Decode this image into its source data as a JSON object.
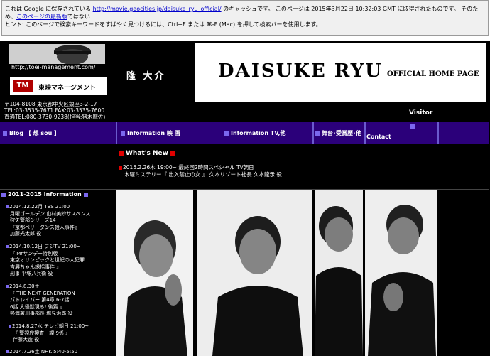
{
  "cache_banner": {
    "line1_a": "これは Google に保存されている ",
    "cached_url": "http://movie.geocities.jp/daisuke_ryu_official/",
    "line1_b": " のキャッシュです。 このページは 2015年3月22日 10:32:03 GMT に取得されたものです。 そのため、",
    "latest_link": "このページの最新版",
    "line1_c": "ではない",
    "line2": "ヒント: このページで検索キーワードをすばやく見つけるには、Ctrl+F または ⌘-F (Mac) を押して検索バーを使用します。"
  },
  "agency": {
    "url": "http://toei-management.com/",
    "name": "東映マネージメント",
    "address": "〒104-8108 東京都中央区銀座3-2-17",
    "tel": "TEL:03-3535-7671 FAX:03-3535-7600",
    "direct": "直通TEL:080-3730-9238(担当:猪木麿佐)"
  },
  "header": {
    "name_ja": "隆 大介",
    "name_en": "DAISUKE RYU",
    "subtitle": "OFFICIAL HOME PAGE",
    "visitor": "Visitor"
  },
  "nav": {
    "blog": "Blog 【 想 sou 】",
    "info_movie": "Information 映 画",
    "info_tv": "Information TV,他",
    "stage": "舞台･受賞歴･他",
    "contact": "Contact"
  },
  "whats_new": {
    "title": "What's New",
    "line1": "2015.2.26木 19:00~ 最終回2時間スペシャル TV朝日",
    "line2": "木曜ミステリー『 出入禁止の女 』 久本リゾート社長 久本龍示 役"
  },
  "sidebar": {
    "title": "2011-2015 Information",
    "items": [
      {
        "lines": [
          "2014.12.22月 TBS 21:00",
          "月曜ゴールデン 山村美紗サスペンス",
          "狩矢警部シリーズ14",
          "『京都ベリーダンス殺人事件』",
          "加藤光太郎 役"
        ]
      },
      {
        "lines": [
          "2014.10.12日 フジTV 21:00~",
          "『 Mrサンデー特別版",
          "東京オリンピックと世紀の大犯罪",
          "吉展ちゃん誘拐事件 』",
          "刑事 平塚八兵衛 役"
        ]
      },
      {
        "lines": [
          "2014.8.30土",
          "『 THE NEXT GENERATION",
          "パトレイバー 第4章 6-7話",
          "6話 大怪獣現る! 後篇 』",
          "熱海署刑事部長 塩見治郎 役"
        ]
      },
      {
        "lines": [
          "2014.8.27水 テレビ朝日 21:00~",
          "『 警視庁捜査一課 9係 』",
          "伴藤大造 役"
        ]
      },
      {
        "lines": [
          "2014.7.26土 NHK 5:40-5:50"
        ]
      }
    ]
  }
}
